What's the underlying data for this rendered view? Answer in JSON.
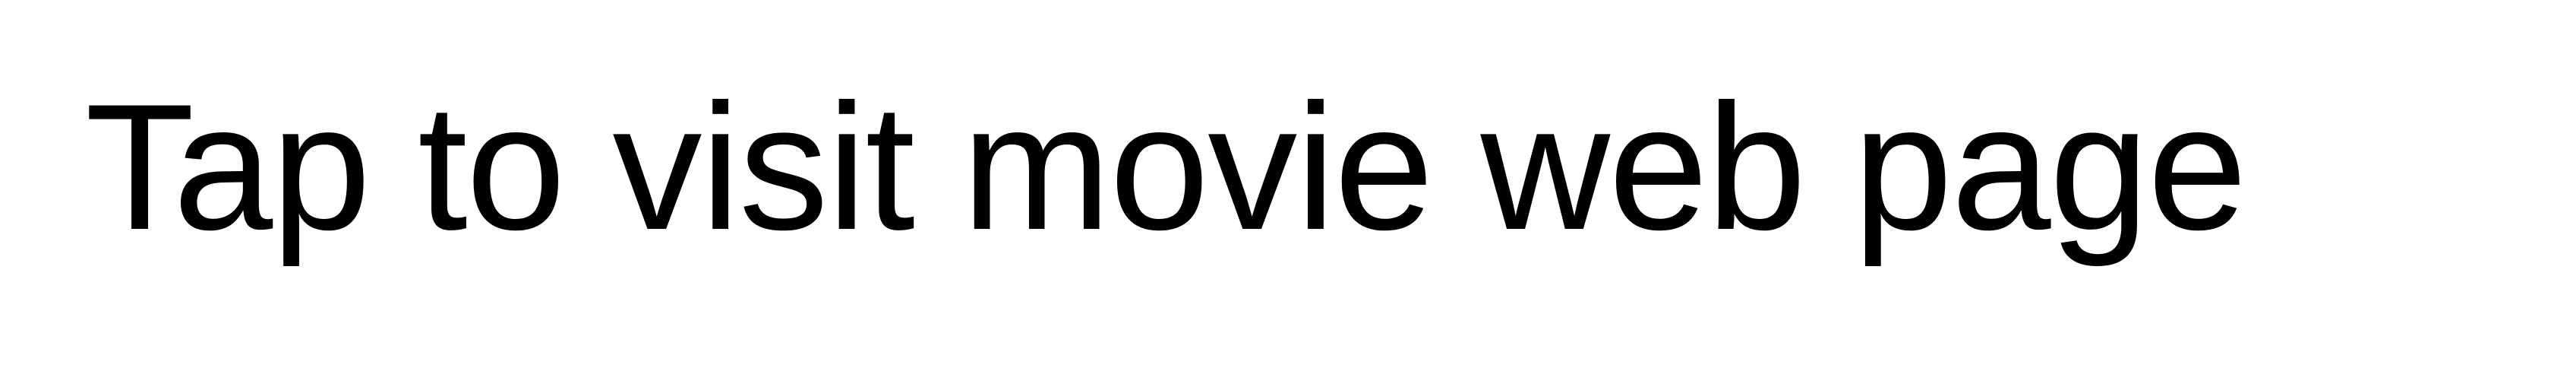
{
  "cta": {
    "label": "Tap to visit movie web page"
  }
}
